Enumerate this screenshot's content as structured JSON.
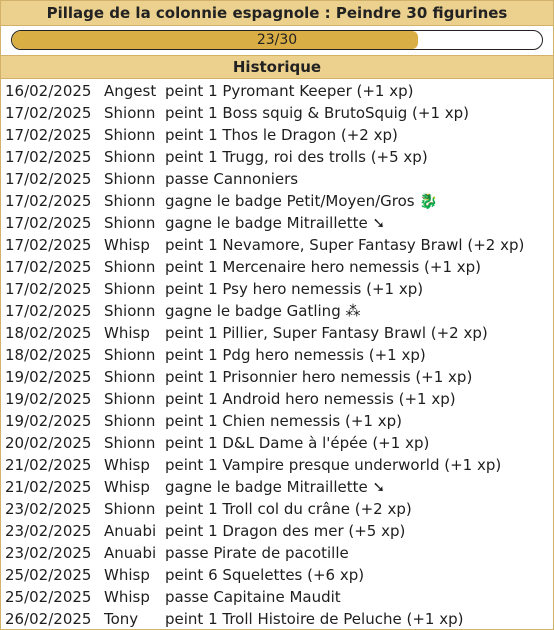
{
  "title": "Pillage de la colonnie espagnole : Peindre 30 figurines",
  "progress": {
    "text": "23/30",
    "current": 23,
    "total": 30,
    "fill_color": "#d9ae45"
  },
  "history_header": "Historique",
  "history": [
    {
      "date": "16/02/2025",
      "user": "Angest",
      "action": "peint 1 Pyromant Keeper (+1 xp)"
    },
    {
      "date": "17/02/2025",
      "user": "Shionn",
      "action": "peint 1 Boss squig & BrutoSquig (+1 xp)"
    },
    {
      "date": "17/02/2025",
      "user": "Shionn",
      "action": "peint 1 Thos le Dragon (+2 xp)"
    },
    {
      "date": "17/02/2025",
      "user": "Shionn",
      "action": "peint 1 Trugg, roi des trolls (+5 xp)"
    },
    {
      "date": "17/02/2025",
      "user": "Shionn",
      "action": "passe Cannoniers"
    },
    {
      "date": "17/02/2025",
      "user": "Shionn",
      "action": "gagne le badge Petit/Moyen/Gros 🐉"
    },
    {
      "date": "17/02/2025",
      "user": "Shionn",
      "action": "gagne le badge Mitraillette ➘"
    },
    {
      "date": "17/02/2025",
      "user": "Whisp",
      "action": "peint 1 Nevamore, Super Fantasy Brawl (+2 xp)"
    },
    {
      "date": "17/02/2025",
      "user": "Shionn",
      "action": "peint 1 Mercenaire hero nemessis (+1 xp)"
    },
    {
      "date": "17/02/2025",
      "user": "Shionn",
      "action": "peint 1 Psy hero nemessis (+1 xp)"
    },
    {
      "date": "17/02/2025",
      "user": "Shionn",
      "action": "gagne le badge Gatling ⁂"
    },
    {
      "date": "18/02/2025",
      "user": "Whisp",
      "action": "peint 1 Pillier, Super Fantasy Brawl (+2 xp)"
    },
    {
      "date": "18/02/2025",
      "user": "Shionn",
      "action": "peint 1 Pdg hero nemessis (+1 xp)"
    },
    {
      "date": "19/02/2025",
      "user": "Shionn",
      "action": "peint 1 Prisonnier hero nemessis (+1 xp)"
    },
    {
      "date": "19/02/2025",
      "user": "Shionn",
      "action": "peint 1 Android hero nemessis (+1 xp)"
    },
    {
      "date": "19/02/2025",
      "user": "Shionn",
      "action": "peint 1 Chien nemessis (+1 xp)"
    },
    {
      "date": "20/02/2025",
      "user": "Shionn",
      "action": "peint 1 D&L Dame à l'épée (+1 xp)"
    },
    {
      "date": "21/02/2025",
      "user": "Whisp",
      "action": "peint 1 Vampire presque underworld (+1 xp)"
    },
    {
      "date": "21/02/2025",
      "user": "Whisp",
      "action": "gagne le badge Mitraillette ➘"
    },
    {
      "date": "23/02/2025",
      "user": "Shionn",
      "action": "peint 1 Troll col du crâne (+2 xp)"
    },
    {
      "date": "23/02/2025",
      "user": "Anuabi",
      "action": "peint 1 Dragon des mer (+5 xp)"
    },
    {
      "date": "23/02/2025",
      "user": "Anuabi",
      "action": "passe Pirate de pacotille"
    },
    {
      "date": "25/02/2025",
      "user": "Whisp",
      "action": "peint 6 Squelettes (+6 xp)"
    },
    {
      "date": "25/02/2025",
      "user": "Whisp",
      "action": "passe Capitaine Maudit"
    },
    {
      "date": "26/02/2025",
      "user": "Tony",
      "action": "peint 1 Troll Histoire de Peluche (+1 xp)"
    }
  ]
}
